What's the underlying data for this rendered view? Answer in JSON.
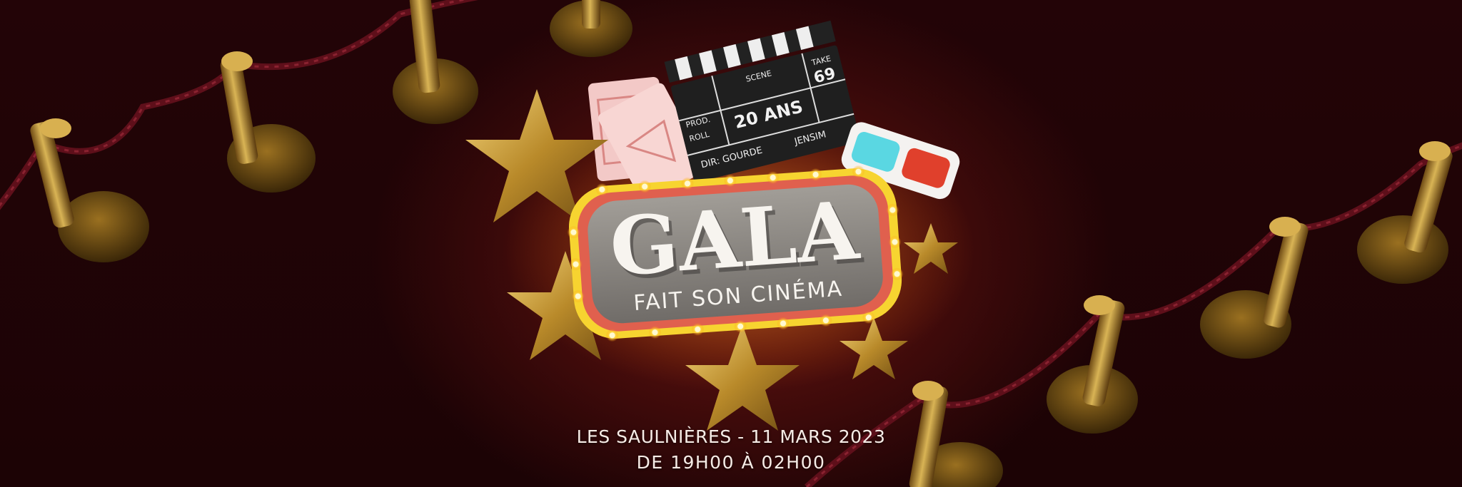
{
  "marquee": {
    "title": "GALA",
    "subtitle": "FAIT SON CINÉMA"
  },
  "clapperboard": {
    "prod_label": "PROD.",
    "roll_label": "ROLL",
    "scene_label": "SCENE",
    "scene_value": "20 ANS",
    "take_label": "TAKE",
    "take_value": "69",
    "director_text": "DIR: GOURDE",
    "extra_text": "JENSIM"
  },
  "event": {
    "venue_date": "LES SAULNIÈRES - 11 MARS 2023",
    "hours": "DE 19H00 À 02H00"
  },
  "colors": {
    "background": "#1c0406",
    "glow": "#7a1d12",
    "gold": "#c9a238",
    "rope": "#6e1420",
    "marquee_face": "#8c8985",
    "marquee_border": "#e0604e",
    "bulb": "#fff6b0",
    "text": "#f6ece6"
  }
}
